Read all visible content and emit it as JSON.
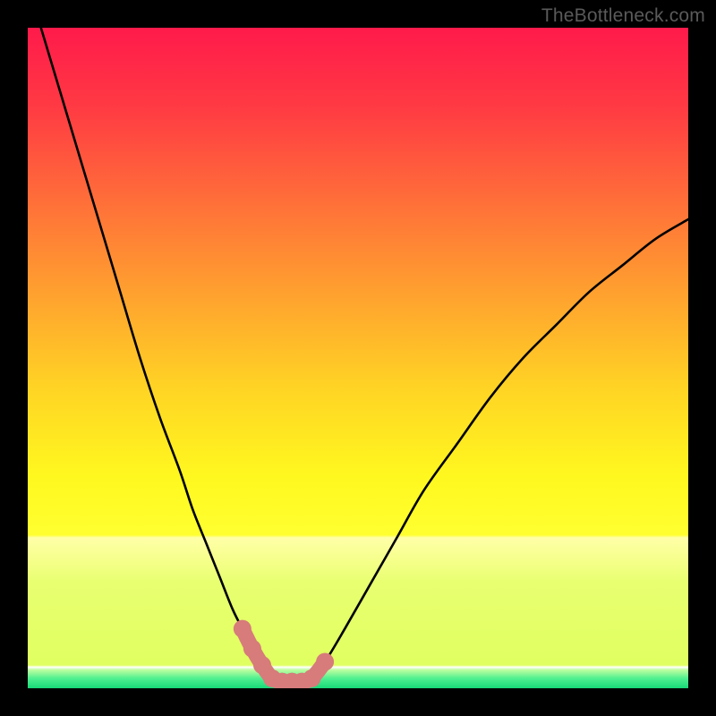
{
  "watermark": "TheBottleneck.com",
  "colors": {
    "frame": "#000000",
    "curve_main": "#000000",
    "marker_fill": "#d77b7b",
    "marker_stroke": "#c96a6a",
    "gradient_stops": [
      {
        "offset": 0.0,
        "color": "#ff1a4b"
      },
      {
        "offset": 0.12,
        "color": "#ff3a43"
      },
      {
        "offset": 0.25,
        "color": "#ff6a3a"
      },
      {
        "offset": 0.4,
        "color": "#ffa02f"
      },
      {
        "offset": 0.55,
        "color": "#ffd524"
      },
      {
        "offset": 0.68,
        "color": "#fff81f"
      },
      {
        "offset": 0.768,
        "color": "#ffff30"
      },
      {
        "offset": 0.772,
        "color": "#ffffa8"
      },
      {
        "offset": 0.8,
        "color": "#f8ff90"
      },
      {
        "offset": 0.84,
        "color": "#e8ff70"
      },
      {
        "offset": 0.965,
        "color": "#e0ff60"
      },
      {
        "offset": 0.968,
        "color": "#ffffff"
      },
      {
        "offset": 0.972,
        "color": "#c0ffa0"
      },
      {
        "offset": 0.985,
        "color": "#50f090"
      },
      {
        "offset": 1.0,
        "color": "#18d878"
      }
    ]
  },
  "chart_data": {
    "type": "line",
    "title": "",
    "xlabel": "",
    "ylabel": "",
    "xlim": [
      0,
      100
    ],
    "ylim": [
      0,
      100
    ],
    "series": [
      {
        "name": "left-curve",
        "x": [
          2,
          5,
          8,
          11,
          14,
          17,
          20,
          23,
          25,
          27,
          29,
          31,
          32.5,
          34,
          35.5,
          37
        ],
        "y": [
          100,
          90,
          80,
          70,
          60,
          50,
          41,
          33,
          27,
          22,
          17,
          12,
          9,
          6,
          3.5,
          1.5
        ]
      },
      {
        "name": "right-curve",
        "x": [
          43,
          45,
          48,
          52,
          56,
          60,
          65,
          70,
          75,
          80,
          85,
          90,
          95,
          100
        ],
        "y": [
          1.5,
          4,
          9,
          16,
          23,
          30,
          37,
          44,
          50,
          55,
          60,
          64,
          68,
          71
        ]
      },
      {
        "name": "valley-markers",
        "x": [
          32.5,
          34,
          35.5,
          37,
          38.5,
          40,
          41.5,
          43,
          45
        ],
        "y": [
          9,
          6,
          3.5,
          1.5,
          1,
          1,
          1,
          1.5,
          4
        ]
      }
    ],
    "annotations": [
      {
        "text": "TheBottleneck.com",
        "pos": "top-right"
      }
    ]
  }
}
